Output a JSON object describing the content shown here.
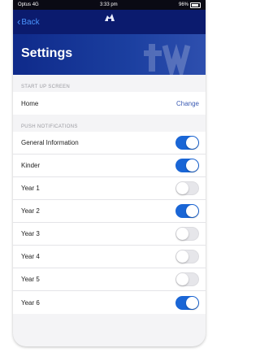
{
  "status": {
    "carrier": "Optus",
    "network": "4G",
    "time": "3:33 pm",
    "battery": "96%"
  },
  "nav": {
    "back_label": "Back"
  },
  "header": {
    "title": "Settings"
  },
  "sections": [
    {
      "heading": "START UP SCREEN",
      "rows": [
        {
          "label": "Home",
          "action": "Change"
        }
      ]
    },
    {
      "heading": "PUSH NOTIFICATIONS",
      "rows": [
        {
          "label": "General Information",
          "enabled": true
        },
        {
          "label": "Kinder",
          "enabled": true
        },
        {
          "label": "Year 1",
          "enabled": false
        },
        {
          "label": "Year 2",
          "enabled": true
        },
        {
          "label": "Year 3",
          "enabled": false
        },
        {
          "label": "Year 4",
          "enabled": false
        },
        {
          "label": "Year 5",
          "enabled": false
        },
        {
          "label": "Year 6",
          "enabled": true
        }
      ]
    }
  ],
  "colors": {
    "nav_bg": "#0b1b6e",
    "header_bg": "#0f2a8a",
    "toggle_on": "#1a66d6",
    "link": "#3b5bb3"
  }
}
